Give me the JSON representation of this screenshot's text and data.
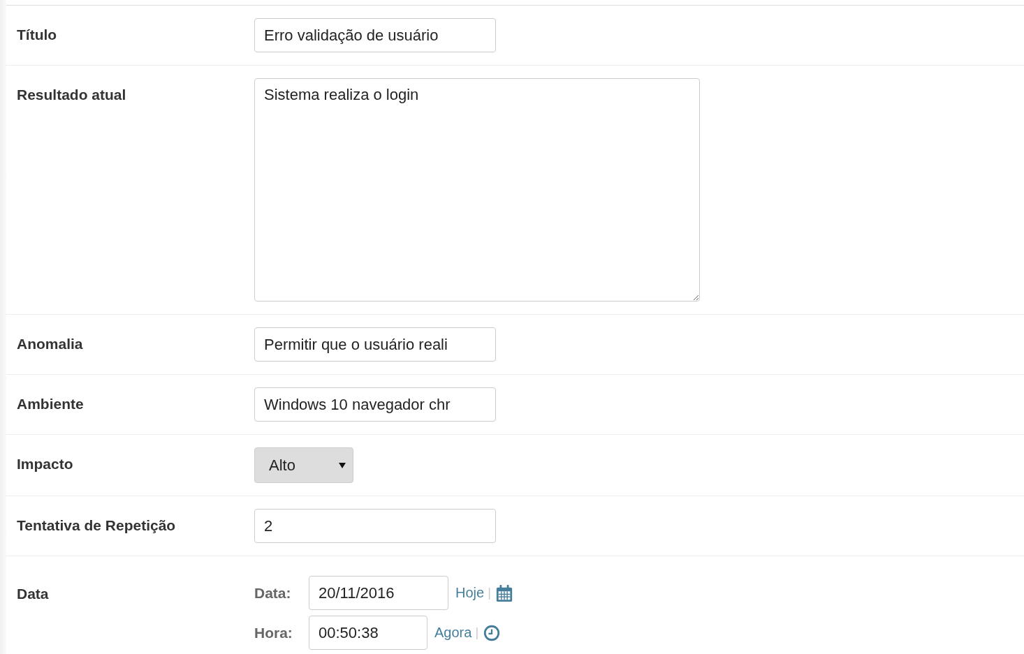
{
  "fields": [
    {
      "kind": "text",
      "label": "Título",
      "value": "Erro validação de usuário"
    },
    {
      "kind": "textarea",
      "label": "Resultado atual",
      "value": "Sistema realiza o login"
    },
    {
      "kind": "text",
      "label": "Anomalia",
      "value": "Permitir que o usuário reali"
    },
    {
      "kind": "text",
      "label": "Ambiente",
      "value": "Windows 10 navegador chr"
    },
    {
      "kind": "select",
      "label": "Impacto",
      "value": "Alto"
    },
    {
      "kind": "text",
      "label": "Tentativa de Repetição",
      "value": "2"
    },
    {
      "kind": "datetime",
      "label": "Data",
      "parts": [
        {
          "kind": "date",
          "label": "Data:",
          "value": "20/11/2016",
          "link": "Hoje",
          "separator": "|"
        },
        {
          "kind": "time",
          "label": "Hora:",
          "value": "00:50:38",
          "link": "Agora",
          "separator": "|"
        }
      ]
    }
  ]
}
